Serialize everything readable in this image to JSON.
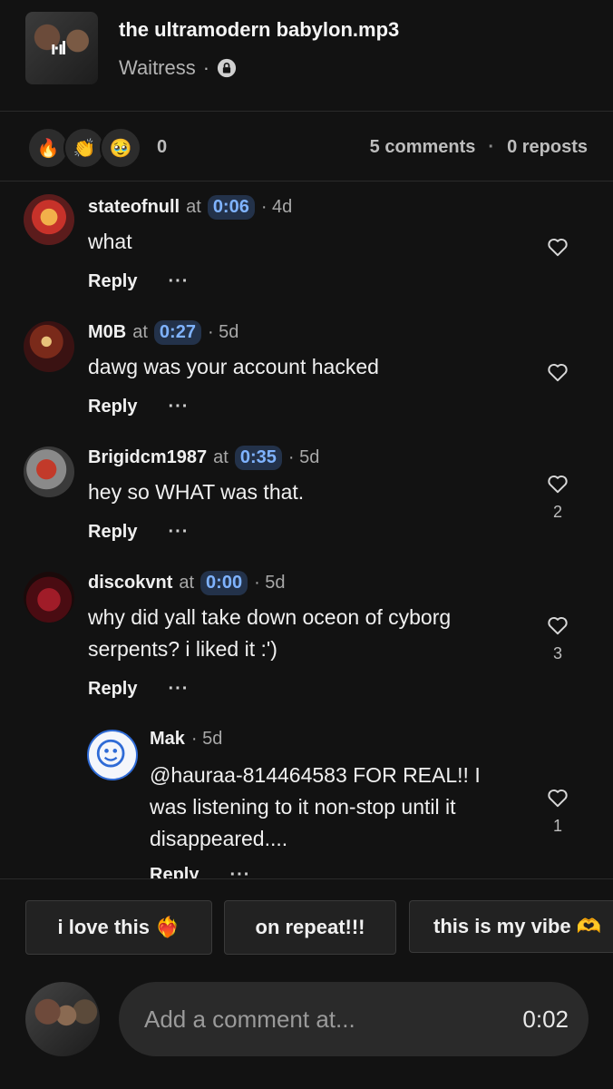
{
  "track": {
    "title": "the ultramodern babylon.mp3",
    "artist": "Waitress",
    "separator": "·",
    "lock_icon": "lock-icon"
  },
  "stats": {
    "reactions": [
      "🔥",
      "👏",
      "🥹"
    ],
    "reaction_count": "0",
    "comments": "5 comments",
    "separator": "·",
    "reposts": "0 reposts"
  },
  "comments": [
    {
      "user": "stateofnull",
      "at": "at",
      "timestamp": "0:06",
      "age": "· 4d",
      "text": "what",
      "reply": "Reply",
      "more": "···",
      "likes": ""
    },
    {
      "user": "M0B",
      "at": "at",
      "timestamp": "0:27",
      "age": "· 5d",
      "text": "dawg was your account hacked",
      "reply": "Reply",
      "more": "···",
      "likes": ""
    },
    {
      "user": "Brigidcm1987",
      "at": "at",
      "timestamp": "0:35",
      "age": "· 5d",
      "text": "hey so WHAT was that.",
      "reply": "Reply",
      "more": "···",
      "likes": "2"
    },
    {
      "user": "discokvnt",
      "at": "at",
      "timestamp": "0:00",
      "age": "· 5d",
      "text": "why did yall take down oceon of cyborg serpents? i liked it :')",
      "reply": "Reply",
      "more": "···",
      "likes": "3"
    },
    {
      "user": "Mak",
      "age": "· 5d",
      "text": "@hauraa-814464583  FOR REAL!! I was listening to it non-stop until it disappeared....",
      "reply": "Reply",
      "more": "···",
      "likes": "1"
    }
  ],
  "quick_replies": [
    "i love this ❤️‍🔥",
    "on repeat!!!",
    "this is my vibe 🫶"
  ],
  "composer": {
    "placeholder": "Add a comment at...",
    "time": "0:02"
  },
  "colors": {
    "background": "#121212",
    "timestamp_bg": "#23324a",
    "timestamp_text": "#7fb3ff"
  }
}
